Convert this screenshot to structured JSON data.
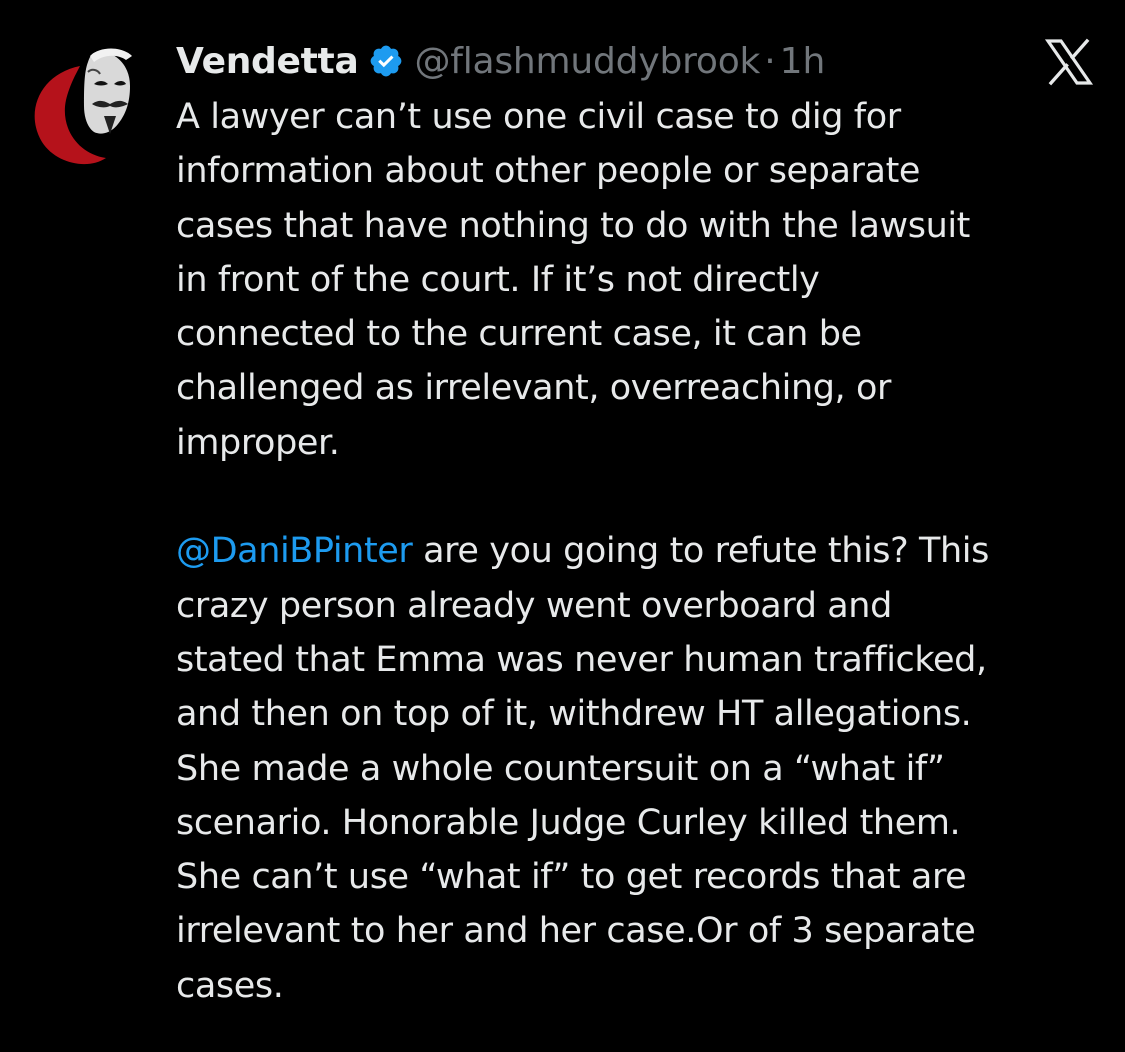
{
  "author": {
    "display_name": "Vendetta",
    "handle": "@flashmuddybrook",
    "separator": "·",
    "time": "1h",
    "verified_icon": "verified-badge-icon",
    "avatar_icon": "guy-fawkes-mask-avatar",
    "verified_color": "#1d9bf0"
  },
  "platform": {
    "logo_icon": "x-logo-icon"
  },
  "tweet": {
    "paragraph1_lines": [
      "A lawyer can’t use one civil case to dig for",
      "information about other people or separate",
      "cases that have nothing to do with the lawsuit",
      "in front of the court. If it’s not directly",
      "connected to the current case, it can be",
      "challenged as irrelevant, overreaching, or",
      "improper."
    ],
    "mention": "@DaniBPinter",
    "mention_line_rest": " are you going to refute this?  This",
    "paragraph2_lines": [
      "crazy person already went overboard and",
      "stated that Emma was never human trafficked,",
      "and then on top of it, withdrew HT allegations.",
      "She made a whole countersuit on a “what if”",
      "scenario. Honorable Judge Curley killed them.",
      "She can’t use “what if” to get records that are",
      "irrelevant to her and her case.Or of 3 separate",
      "cases."
    ]
  },
  "colors": {
    "background": "#000000",
    "text": "#e7e9ea",
    "secondary": "#71767b",
    "link": "#1d9bf0"
  }
}
